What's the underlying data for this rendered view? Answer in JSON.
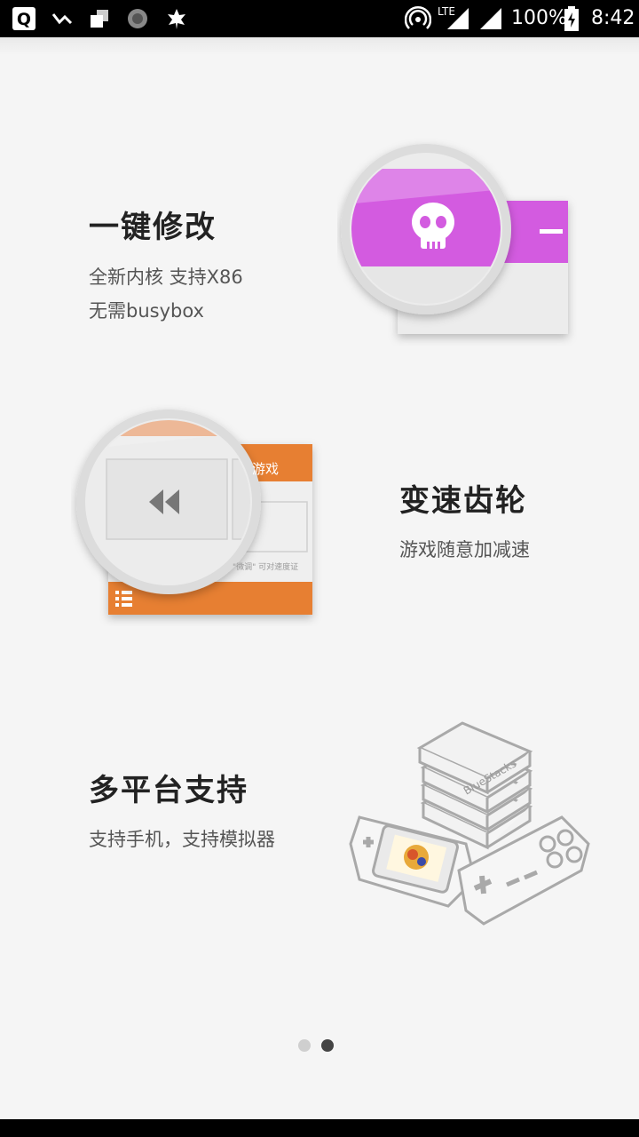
{
  "statusbar": {
    "battery": "100%",
    "time": "8:42",
    "network": "LTE",
    "icons": [
      "q-app-icon",
      "missed-call-icon",
      "square-app-icon",
      "circle-app-icon",
      "leaf-app-icon",
      "hotspot-icon",
      "signal-icon",
      "signal-icon",
      "battery-charging-icon"
    ]
  },
  "features": [
    {
      "title": "一键修改",
      "lines": [
        "全新内核  支持X86",
        "无需busybox"
      ]
    },
    {
      "title": "变速齿轮",
      "lines": [
        "游戏随意加减速"
      ]
    },
    {
      "title": "多平台支持",
      "lines": [
        "支持手机，支持模拟器"
      ]
    }
  ],
  "illustration": {
    "panel2_label": "游戏",
    "panel2_caption": "\"微调\" 可对速度证",
    "console_brand": "BlueStacks"
  },
  "pager": {
    "total": 2,
    "active": 2
  },
  "colors": {
    "accent_purple": "#d35be0",
    "accent_orange": "#e77f32",
    "text_dark": "#222222"
  }
}
